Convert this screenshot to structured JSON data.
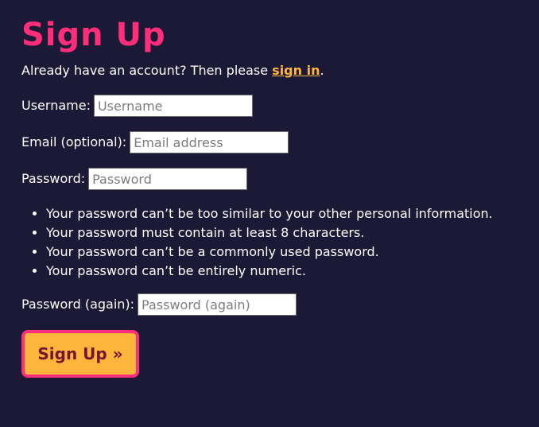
{
  "page": {
    "title": "Sign Up",
    "intro_text": "Already have an account? Then please ",
    "sign_in_link": "sign in",
    "intro_end": "."
  },
  "form": {
    "username": {
      "label": "Username:",
      "placeholder": "Username",
      "value": ""
    },
    "email": {
      "label": "Email (optional):",
      "placeholder": "Email address",
      "value": ""
    },
    "password": {
      "label": "Password:",
      "placeholder": "Password",
      "value": ""
    },
    "password_rules": [
      "Your password can’t be too similar to your other personal information.",
      "Your password must contain at least 8 characters.",
      "Your password can’t be a commonly used password.",
      "Your password can’t be entirely numeric."
    ],
    "password_again": {
      "label": "Password (again):",
      "placeholder": "Password (again)",
      "value": ""
    },
    "submit_label": "Sign Up »"
  },
  "colors": {
    "background": "#1c1936",
    "title": "#ff2d7a",
    "link": "#ffb43c",
    "button_fill": "#ffb43c",
    "button_border": "#ff2d7a",
    "button_text": "#7a1530"
  }
}
